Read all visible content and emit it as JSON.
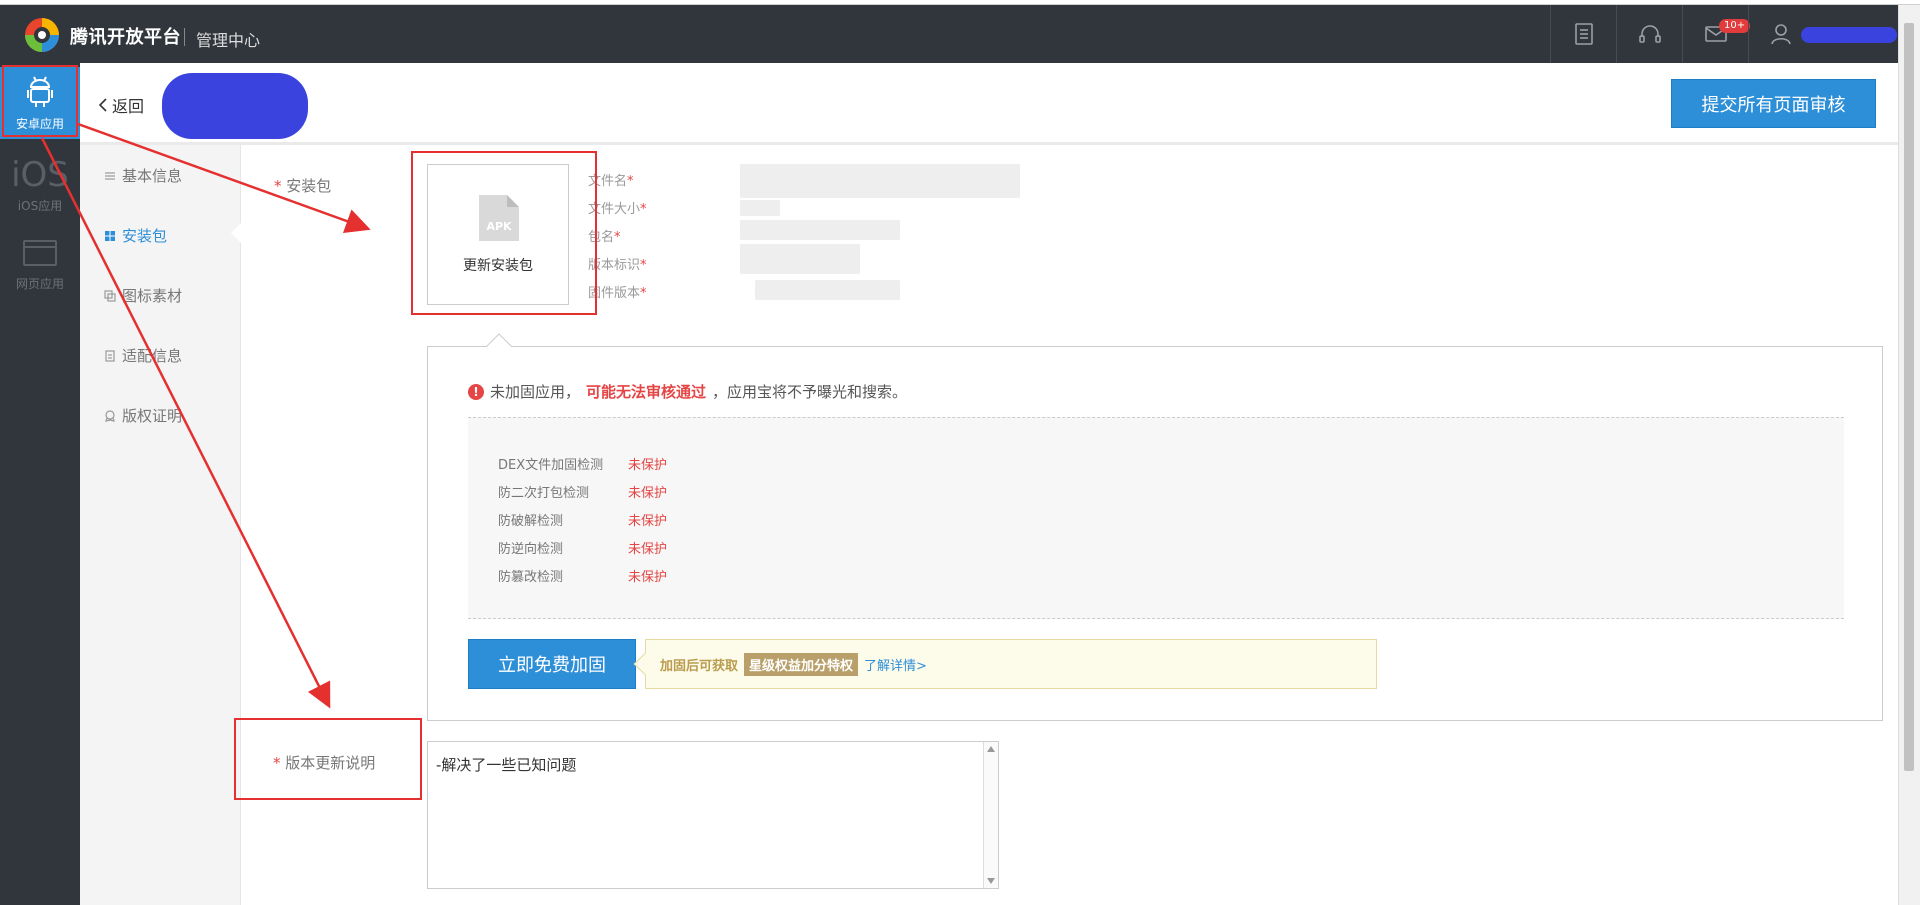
{
  "header": {
    "brand": "腾讯开放平台",
    "subtitle": "管理中心",
    "mail_badge": "10+",
    "icons": [
      "document-icon",
      "headset-icon",
      "mail-icon",
      "user-icon"
    ]
  },
  "left_nav": {
    "items": [
      {
        "label": "安卓应用",
        "icon": "android-icon",
        "active": true
      },
      {
        "label": "iOS应用",
        "icon_text": "iOS",
        "active": false
      },
      {
        "label": "网页应用",
        "icon": "browser-icon",
        "active": false
      }
    ]
  },
  "topbar": {
    "back_label": "返回",
    "submit_all_label": "提交所有页面审核"
  },
  "side_menu": {
    "items": [
      {
        "label": "基本信息",
        "icon": "list-icon"
      },
      {
        "label": "安装包",
        "icon": "grid-icon",
        "active": true
      },
      {
        "label": "图标素材",
        "icon": "image-icon"
      },
      {
        "label": "适配信息",
        "icon": "doc-icon"
      },
      {
        "label": "版权证明",
        "icon": "badge-icon"
      }
    ]
  },
  "package": {
    "label": "安装包",
    "upload_label": "更新安装包",
    "apk_tag": "APK",
    "meta_labels": [
      "文件名",
      "文件大小",
      "包名",
      "版本标识",
      "固件版本"
    ]
  },
  "hardening": {
    "warn_prefix": "未加固应用，",
    "warn_highlight": "可能无法审核通过",
    "warn_suffix": "，应用宝将不予曝光和搜索。",
    "checks": [
      {
        "name": "DEX文件加固检测",
        "status": "未保护"
      },
      {
        "name": "防二次打包检测",
        "status": "未保护"
      },
      {
        "name": "防破解检测",
        "status": "未保护"
      },
      {
        "name": "防逆向检测",
        "status": "未保护"
      },
      {
        "name": "防篡改检测",
        "status": "未保护"
      }
    ],
    "button_label": "立即免费加固",
    "promo_text": "加固后可获取",
    "promo_tag": "星级权益加分特权",
    "promo_link": "了解详情>"
  },
  "version_notes": {
    "label": "版本更新说明",
    "value": "-解决了一些已知问题"
  },
  "colors": {
    "accent": "#2e8fd9",
    "topbar": "#31363d",
    "warning": "#e54545",
    "annotation": "#e53030"
  }
}
